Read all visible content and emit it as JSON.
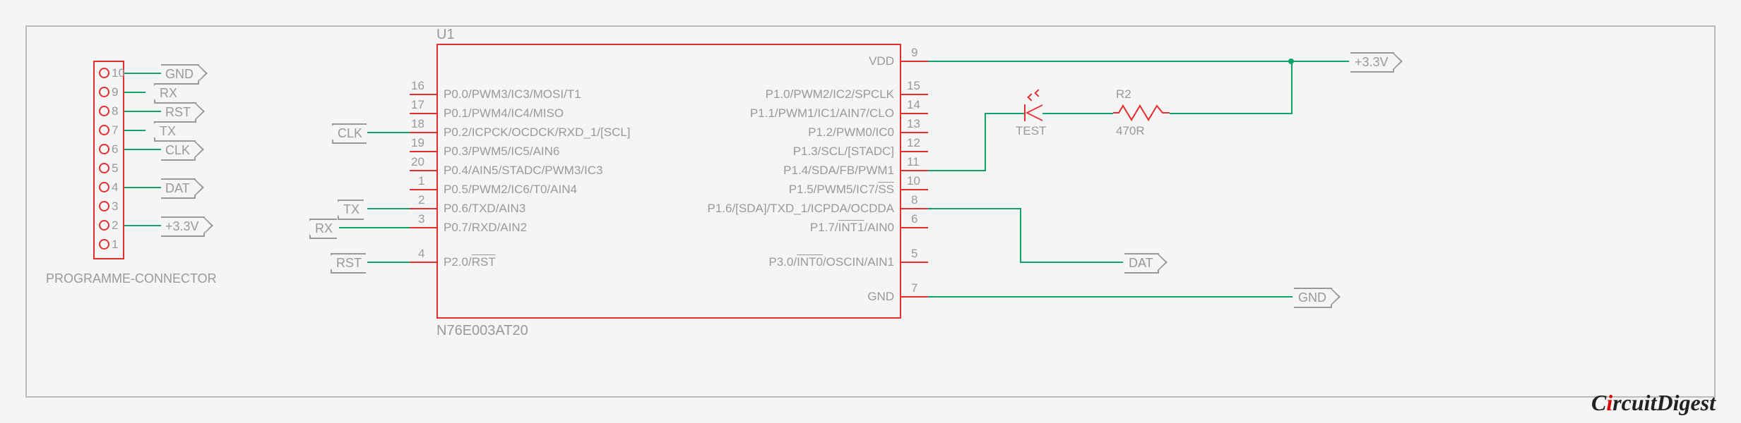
{
  "connector": {
    "name": "PROGRAMME-CONNECTOR",
    "pins": [
      "1",
      "2",
      "3",
      "4",
      "5",
      "6",
      "7",
      "8",
      "9",
      "10"
    ],
    "nets": {
      "10": "GND",
      "9": "RX",
      "8": "RST",
      "7": "TX",
      "6": "CLK",
      "4": "DAT",
      "2": "+3.3V"
    }
  },
  "ic": {
    "ref": "U1",
    "part": "N76E003AT20",
    "left_pins": [
      {
        "num": "16",
        "lbl": "P0.0/PWM3/IC3/MOSI/T1"
      },
      {
        "num": "17",
        "lbl": "P0.1/PWM4/IC4/MISO"
      },
      {
        "num": "18",
        "lbl": "P0.2/ICPCK/OCDCK/RXD_1/[SCL]"
      },
      {
        "num": "19",
        "lbl": "P0.3/PWM5/IC5/AIN6"
      },
      {
        "num": "20",
        "lbl": "P0.4/AIN5/STADC/PWM3/IC3"
      },
      {
        "num": "1",
        "lbl": "P0.5/PWM2/IC6/T0/AIN4"
      },
      {
        "num": "2",
        "lbl": "P0.6/TXD/AIN3"
      },
      {
        "num": "3",
        "lbl": "P0.7/RXD/AIN2"
      },
      {
        "num": "4",
        "lbl": "P2.0/RST"
      }
    ],
    "right_pins": [
      {
        "num": "9",
        "lbl": "VDD"
      },
      {
        "num": "15",
        "lbl": "P1.0/PWM2/IC2/SPCLK"
      },
      {
        "num": "14",
        "lbl": "P1.1/PWM1/IC1/AIN7/CLO"
      },
      {
        "num": "13",
        "lbl": "P1.2/PWM0/IC0"
      },
      {
        "num": "12",
        "lbl": "P1.3/SCL/[STADC]"
      },
      {
        "num": "11",
        "lbl": "P1.4/SDA/FB/PWM1"
      },
      {
        "num": "10",
        "lbl": "P1.5/PWM5/IC7/SS"
      },
      {
        "num": "8",
        "lbl": "P1.6/[SDA]/TXD_1/ICPDA/OCDDA"
      },
      {
        "num": "6",
        "lbl": "P1.7/INT1/AIN0"
      },
      {
        "num": "5",
        "lbl": "P3.0/INT0/OSCIN/AIN1"
      },
      {
        "num": "7",
        "lbl": "GND"
      }
    ]
  },
  "led": {
    "name": "TEST"
  },
  "resistor": {
    "ref": "R2",
    "value": "470R"
  },
  "right_nets": {
    "vdd": "+3.3V",
    "dat": "DAT",
    "gnd": "GND"
  },
  "left_nets": {
    "clk": "CLK",
    "tx": "TX",
    "rx": "RX",
    "rst": "RST"
  },
  "watermark": "CircuitDigest"
}
